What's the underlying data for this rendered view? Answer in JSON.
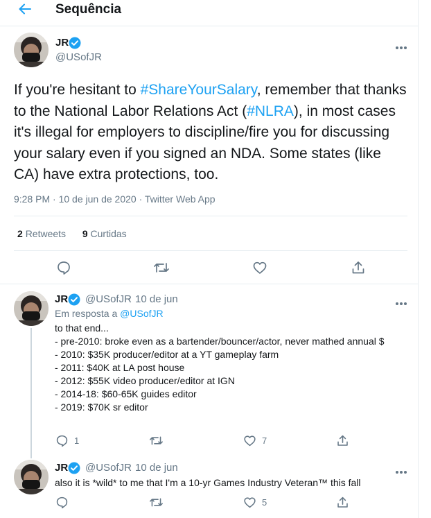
{
  "header": {
    "title": "Sequência"
  },
  "main_tweet": {
    "author_name": "JR",
    "author_handle": "@USofJR",
    "text_parts": [
      {
        "text": "If you're hesitant to ",
        "link": false
      },
      {
        "text": "#ShareYourSalary",
        "link": true
      },
      {
        "text": ", remember that thanks to the National Labor Relations Act (",
        "link": false
      },
      {
        "text": "#NLRA",
        "link": true
      },
      {
        "text": "), in most cases it's illegal for employers to discipline/fire you for discussing your salary even if you signed an NDA. Some states (like CA) have extra protections, too.",
        "link": false
      }
    ],
    "meta": "9:28 PM · 10 de jun de 2020 · Twitter Web App",
    "retweets_count": "2",
    "retweets_label": "Retweets",
    "likes_count": "9",
    "likes_label": "Curtidas"
  },
  "replies": [
    {
      "author_name": "JR",
      "author_handle": "@USofJR",
      "dot": "·",
      "date": "10 de jun",
      "reply_prefix": "Em resposta a",
      "reply_handle": "@USofJR",
      "lines": [
        "to that end...",
        "- pre-2010: broke even as a bartender/bouncer/actor, never mathed annual $",
        "- 2010: $35K producer/editor at a YT gameplay farm",
        "- 2011: $40K at LA post house",
        "- 2012: $55K video producer/editor at IGN",
        "- 2014-18: $60-65K guides editor",
        "- 2019: $70K sr editor"
      ],
      "reply_count": "1",
      "like_count": "7"
    },
    {
      "author_name": "JR",
      "author_handle": "@USofJR",
      "dot": "·",
      "date": "10 de jun",
      "text": "also it is *wild* to me that I'm a 10-yr Games Industry Veteran™ this fall",
      "like_count": "5"
    }
  ],
  "colors": {
    "accent": "#1da1f2",
    "secondary": "#657786",
    "border": "#e6ecf0"
  },
  "icons": [
    "back-arrow-icon",
    "verified-badge-icon",
    "more-options-icon",
    "reply-icon",
    "retweet-icon",
    "like-icon",
    "share-icon"
  ]
}
